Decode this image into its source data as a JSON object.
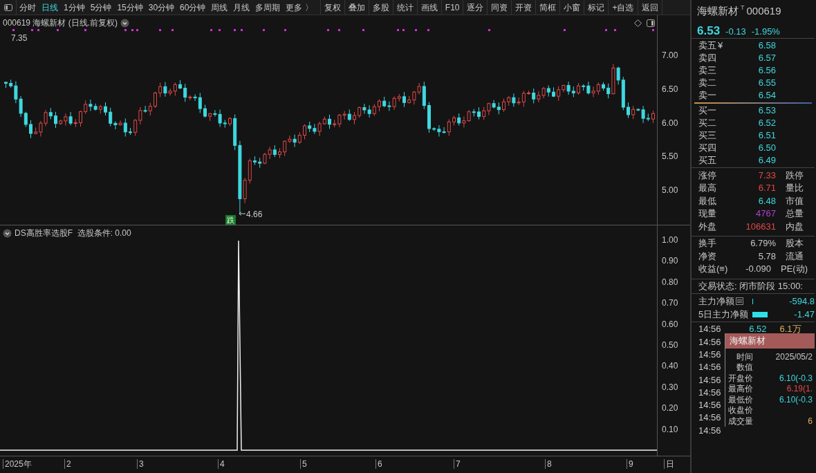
{
  "toolbar": {
    "period_tabs": [
      {
        "label": "分时",
        "selected": false
      },
      {
        "label": "日线",
        "selected": true
      },
      {
        "label": "1分钟",
        "selected": false
      },
      {
        "label": "5分钟",
        "selected": false
      },
      {
        "label": "15分钟",
        "selected": false
      },
      {
        "label": "30分钟",
        "selected": false
      },
      {
        "label": "60分钟",
        "selected": false
      },
      {
        "label": "周线",
        "selected": false
      },
      {
        "label": "月线",
        "selected": false
      },
      {
        "label": "多周期",
        "selected": false
      },
      {
        "label": "更多 〉",
        "selected": false
      }
    ],
    "buttons": [
      "复权",
      "叠加",
      "多股",
      "统计",
      "画线",
      "F10",
      "逐分",
      "同资",
      "开资",
      "简框",
      "小窗",
      "标记",
      "+自选",
      "返回"
    ]
  },
  "chart": {
    "header": "000619 海螺新材 (日线.前复权)",
    "high_label": "7.35",
    "low_label": "4.66",
    "signal_badge": "跌",
    "price_ticks": [
      "7.00",
      "6.50",
      "6.00",
      "5.50",
      "5.00"
    ]
  },
  "indicator": {
    "header": "DS高胜率选股F  选股条件: 0.00",
    "ticks": [
      "1.00",
      "0.90",
      "0.80",
      "0.70",
      "0.60",
      "0.50",
      "0.40",
      "0.30",
      "0.20",
      "0.10"
    ]
  },
  "x_axis": [
    "2025年",
    "2",
    "3",
    "4",
    "5",
    "6",
    "7",
    "8",
    "9",
    "日"
  ],
  "quote": {
    "name": "海螺新材",
    "tag": "T",
    "code": "000619",
    "price": "6.53",
    "change": "-0.13",
    "change_pct": "-1.95%"
  },
  "order_book": {
    "asks": [
      {
        "label": "卖五",
        "mark": "¥",
        "price": "6.58"
      },
      {
        "label": "卖四",
        "price": "6.57"
      },
      {
        "label": "卖三",
        "price": "6.56"
      },
      {
        "label": "卖二",
        "price": "6.55"
      },
      {
        "label": "卖一",
        "price": "6.54"
      }
    ],
    "bids": [
      {
        "label": "买一",
        "price": "6.53"
      },
      {
        "label": "买二",
        "price": "6.52"
      },
      {
        "label": "买三",
        "price": "6.51"
      },
      {
        "label": "买四",
        "price": "6.50"
      },
      {
        "label": "买五",
        "price": "6.49"
      }
    ]
  },
  "stats": [
    {
      "label": "涨停",
      "value": "7.33",
      "color": "#e04848",
      "label_2": "跌停"
    },
    {
      "label": "最高",
      "value": "6.71",
      "color": "#e04848",
      "label_2": "量比"
    },
    {
      "label": "最低",
      "value": "6.48",
      "color": "#3fd8e0",
      "label_2": "市值"
    },
    {
      "label": "现量",
      "value": "4767",
      "color": "#b040d0",
      "label_2": "总量"
    },
    {
      "label": "外盘",
      "value": "106631",
      "color": "#e04848",
      "label_2": "内盘"
    }
  ],
  "stats_2": [
    {
      "label": "换手",
      "value": "6.79%",
      "label_2": "股本"
    },
    {
      "label": "净资",
      "value": "5.78",
      "label_2": "流通"
    },
    {
      "label": "收益(≡)",
      "value": "-0.090",
      "label_2": "PE(动)"
    }
  ],
  "trade_status": "交易状态: 闭市阶段 15:00:",
  "fund_flow": [
    {
      "label": "主力净额",
      "value": "-594.8"
    },
    {
      "label": "5日主力净额",
      "value": "-1.47"
    }
  ],
  "trades": [
    {
      "time": "14:56",
      "price": "6.52",
      "volume": "6.1万"
    },
    {
      "time": "14:56"
    },
    {
      "time": "14:56"
    },
    {
      "time": "14:56"
    },
    {
      "time": "14:56"
    },
    {
      "time": "14:56"
    },
    {
      "time": "14:56"
    },
    {
      "time": "14:56"
    },
    {
      "time": "14:56"
    }
  ],
  "tooltip": {
    "title": "海螺新材",
    "rows": [
      {
        "label": "时间",
        "value": "2025/05/2",
        "color": "#c8c8c8"
      },
      {
        "label": "数值"
      },
      {
        "label": "开盘价",
        "value": "6.10(-0.3",
        "color": "#3fd8e0"
      },
      {
        "label": "最高价",
        "value": "6.19(1.",
        "color": "#e04848"
      },
      {
        "label": "最低价",
        "value": "6.10(-0.3",
        "color": "#3fd8e0"
      },
      {
        "label": "收盘价"
      },
      {
        "label": "成交量",
        "value": "6",
        "color": "#e0b060"
      }
    ]
  }
}
